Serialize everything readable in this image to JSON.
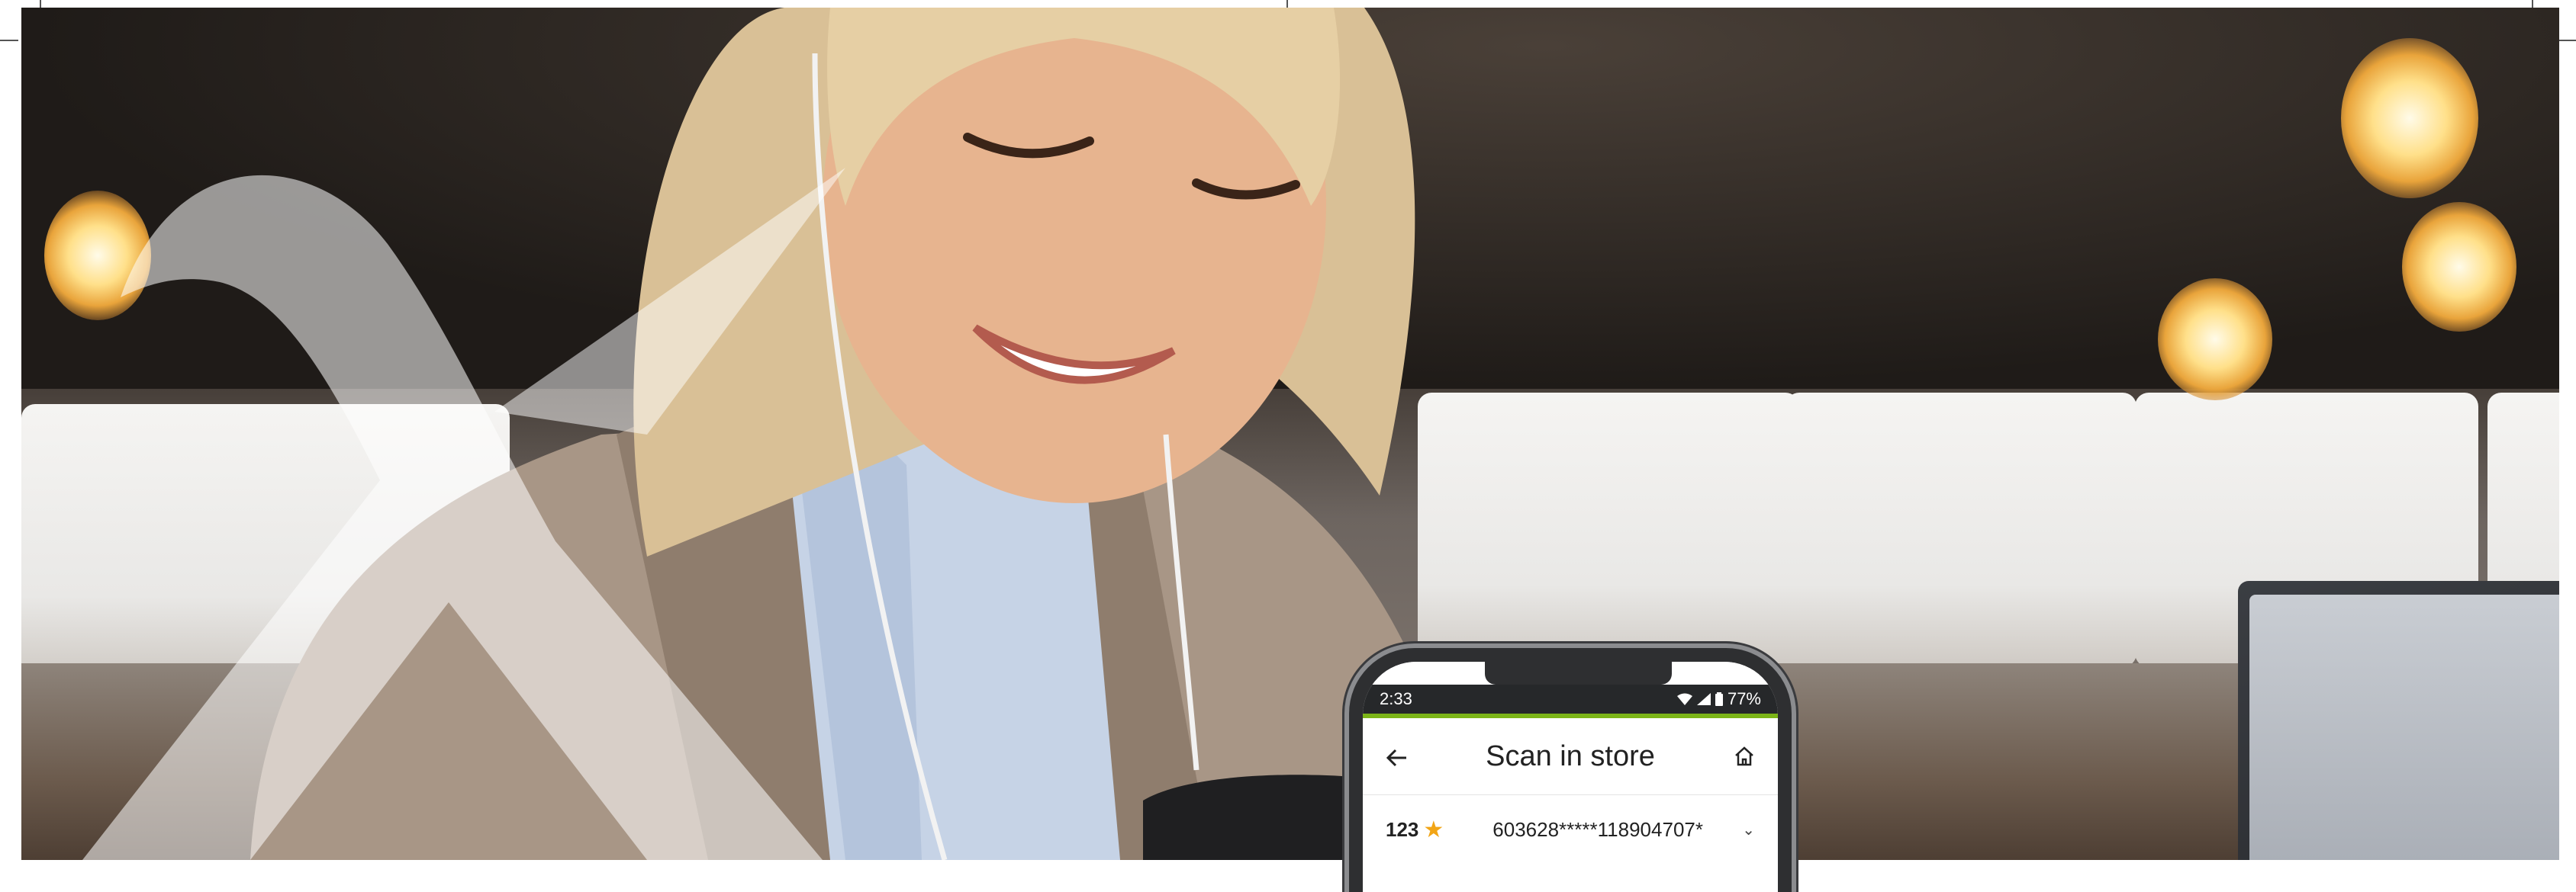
{
  "phone": {
    "status_time": "2:33",
    "battery": "77%",
    "screen_title": "Scan in store",
    "account": {
      "number": "123",
      "card_masked": "603628*****118904707*"
    }
  },
  "icons": {
    "back": "back-arrow-icon",
    "home": "home-icon",
    "favorite": "star-icon",
    "expand": "chevron-down-icon",
    "wifi": "wifi-icon",
    "signal": "signal-icon",
    "battery": "battery-icon"
  },
  "colors": {
    "accent": "#7cb518",
    "star": "#f2a516",
    "status_bar": "#26282a"
  }
}
